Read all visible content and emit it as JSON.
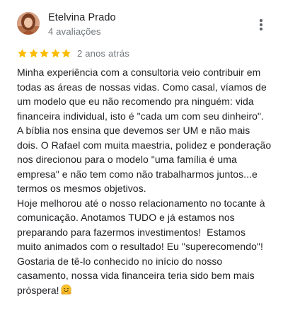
{
  "review": {
    "author_name": "Etelvina Prado",
    "author_reviews": "4 avaliações",
    "rating": 5,
    "rating_max": 5,
    "star_color": "#fbbc04",
    "time_ago": "2 anos atrás",
    "text": "Minha experiência com a consultoria veio contribuir em\ntodas as áreas de nossas vidas. Como casal, víamos de\num modelo que eu não recomendo pra ninguém: vida\nfinanceira individual, isto é \"cada um com seu dinheiro\".\nA bíblia nos ensina que devemos ser UM e não mais\ndois. O Rafael com muita maestria, polidez e ponderação\nnos direcionou para o modelo \"uma família é uma\nempresa\" e não tem como não trabalharmos juntos...e\ntermos os mesmos objetivos.\nHoje melhorou até o nosso relacionamento no tocante à\ncomunicação. Anotamos TUDO e já estamos nos\npreparando para fazermos investimentos!  Estamos\nmuito animados com o resultado! Eu \"superecomendo\"!\nGostaria de tê-lo conhecido no início do nosso\ncasamento, nossa vida financeira teria sido bem mais\npróspera!",
    "trailing_emoji": "hugging-face-icon"
  },
  "icons": {
    "more": "more-vert-icon",
    "star": "star-icon",
    "avatar": "avatar-photo"
  }
}
